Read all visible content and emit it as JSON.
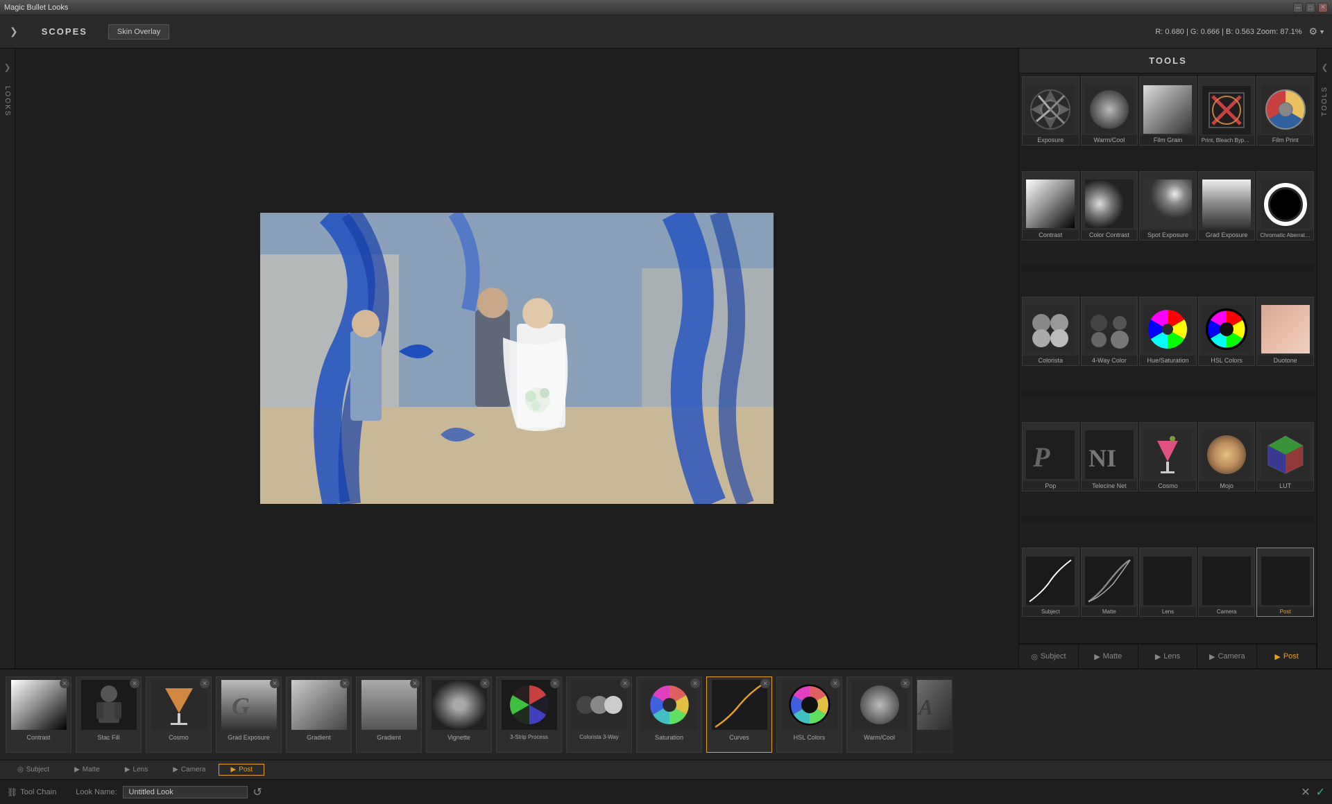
{
  "app": {
    "title": "Magic Bullet Looks"
  },
  "titlebar": {
    "title": "Magic Bullet Looks",
    "close_btn": "✕",
    "minimize_btn": "─",
    "maximize_btn": "□"
  },
  "topbar": {
    "arrow_label": "❯",
    "scopes_label": "SCOPES",
    "skin_overlay_label": "Skin Overlay",
    "color_info": "R: 0.680 | G: 0.666 | B: 0.563    Zoom: 87.1%",
    "gear_label": "⚙"
  },
  "tools": {
    "header": "TOOLS",
    "sections": [
      {
        "name": "section1",
        "items": [
          {
            "id": "exposure",
            "label": "Exposure"
          },
          {
            "id": "warm-cool",
            "label": "Warm/Cool"
          },
          {
            "id": "film-grain",
            "label": "Film Grain"
          },
          {
            "id": "print-bleach",
            "label": "Print, Bleach Bypass"
          },
          {
            "id": "film-print",
            "label": "Film Print"
          }
        ]
      },
      {
        "name": "section2",
        "items": [
          {
            "id": "contrast",
            "label": "Contrast"
          },
          {
            "id": "color-contrast",
            "label": "Color Contrast"
          },
          {
            "id": "spot-exposure",
            "label": "Spot Exposure"
          },
          {
            "id": "grad-exposure",
            "label": "Grad Exposure"
          },
          {
            "id": "chromatic-aberration",
            "label": "Chromatic Aberration"
          }
        ]
      },
      {
        "name": "section3",
        "items": [
          {
            "id": "colorista",
            "label": "Colorista"
          },
          {
            "id": "4way-color",
            "label": "4-Way Color"
          },
          {
            "id": "hue-saturation",
            "label": "Hue/Saturation"
          },
          {
            "id": "hsl-colors",
            "label": "HSL Colors"
          },
          {
            "id": "duotone",
            "label": "Duotone"
          }
        ]
      },
      {
        "name": "section4",
        "items": [
          {
            "id": "pop",
            "label": "Pop"
          },
          {
            "id": "telecine-net",
            "label": "Telecine Net"
          },
          {
            "id": "cosmo",
            "label": "Cosmo"
          },
          {
            "id": "mojo",
            "label": "Mojo"
          },
          {
            "id": "lut",
            "label": "LUT"
          }
        ]
      },
      {
        "name": "section5",
        "items": [
          {
            "id": "curves-subject",
            "label": "Curves (Subject)"
          },
          {
            "id": "curves-matte",
            "label": "Curves (Matte)"
          },
          {
            "id": "curves-lens",
            "label": "Curves (Lens)"
          },
          {
            "id": "curves-camera",
            "label": "Curves (Camera)"
          },
          {
            "id": "curves-post",
            "label": ""
          }
        ]
      }
    ],
    "bottom_tabs": [
      {
        "id": "subject",
        "label": "Subject",
        "icon": "◎"
      },
      {
        "id": "matte",
        "label": "Matte",
        "icon": "▶"
      },
      {
        "id": "lens",
        "label": "Lens",
        "icon": "▶"
      },
      {
        "id": "camera",
        "label": "Camera",
        "icon": "▶"
      },
      {
        "id": "post",
        "label": "Post",
        "active": true,
        "icon": "▶"
      }
    ]
  },
  "strip": {
    "items": [
      {
        "id": "contrast",
        "label": "Contrast",
        "type": "contrast"
      },
      {
        "id": "stac-fill",
        "label": "Stac Fill",
        "type": "portrait"
      },
      {
        "id": "cosmo2",
        "label": "Cosmo",
        "type": "cosmo"
      },
      {
        "id": "grad-exposure2",
        "label": "Grad Exposure",
        "type": "grad"
      },
      {
        "id": "gradient2",
        "label": "Gradient",
        "type": "gradient"
      },
      {
        "id": "gradient3",
        "label": "Gradient",
        "type": "gradient2"
      },
      {
        "id": "vignette",
        "label": "Vignette",
        "type": "vignette"
      },
      {
        "id": "3strip",
        "label": "3-Strip Process",
        "type": "3strip"
      },
      {
        "id": "colorista3way",
        "label": "Colorista 3-Way",
        "type": "colorista3way"
      },
      {
        "id": "saturation",
        "label": "Saturation",
        "type": "saturation"
      },
      {
        "id": "curves",
        "label": "Curves",
        "type": "curves"
      },
      {
        "id": "hsl-colors2",
        "label": "HSL Colors",
        "type": "hslcolors"
      },
      {
        "id": "warm-cool2",
        "label": "Warm/Cool",
        "type": "warmcool"
      }
    ],
    "tabs": [
      {
        "id": "subject2",
        "label": "Subject",
        "icon": "◎"
      },
      {
        "id": "matte2",
        "label": "Matte",
        "icon": "▶"
      },
      {
        "id": "lens2",
        "label": "Lens",
        "icon": "▶"
      },
      {
        "id": "camera2",
        "label": "Camera",
        "icon": "▶"
      },
      {
        "id": "post2",
        "label": "Post",
        "active": true,
        "icon": "▶"
      }
    ]
  },
  "toolbar": {
    "tool_chain_label": "Tool Chain",
    "look_name_label": "Look Name:",
    "look_name_value": "Untitled Look",
    "reset_icon": "↺",
    "close_icon": "✕",
    "confirm_icon": "✓"
  },
  "sidebar_left": {
    "arrow": "❯",
    "label": "LOOKS"
  },
  "sidebar_right": {
    "arrow": "❮",
    "label": "TOOLS"
  }
}
